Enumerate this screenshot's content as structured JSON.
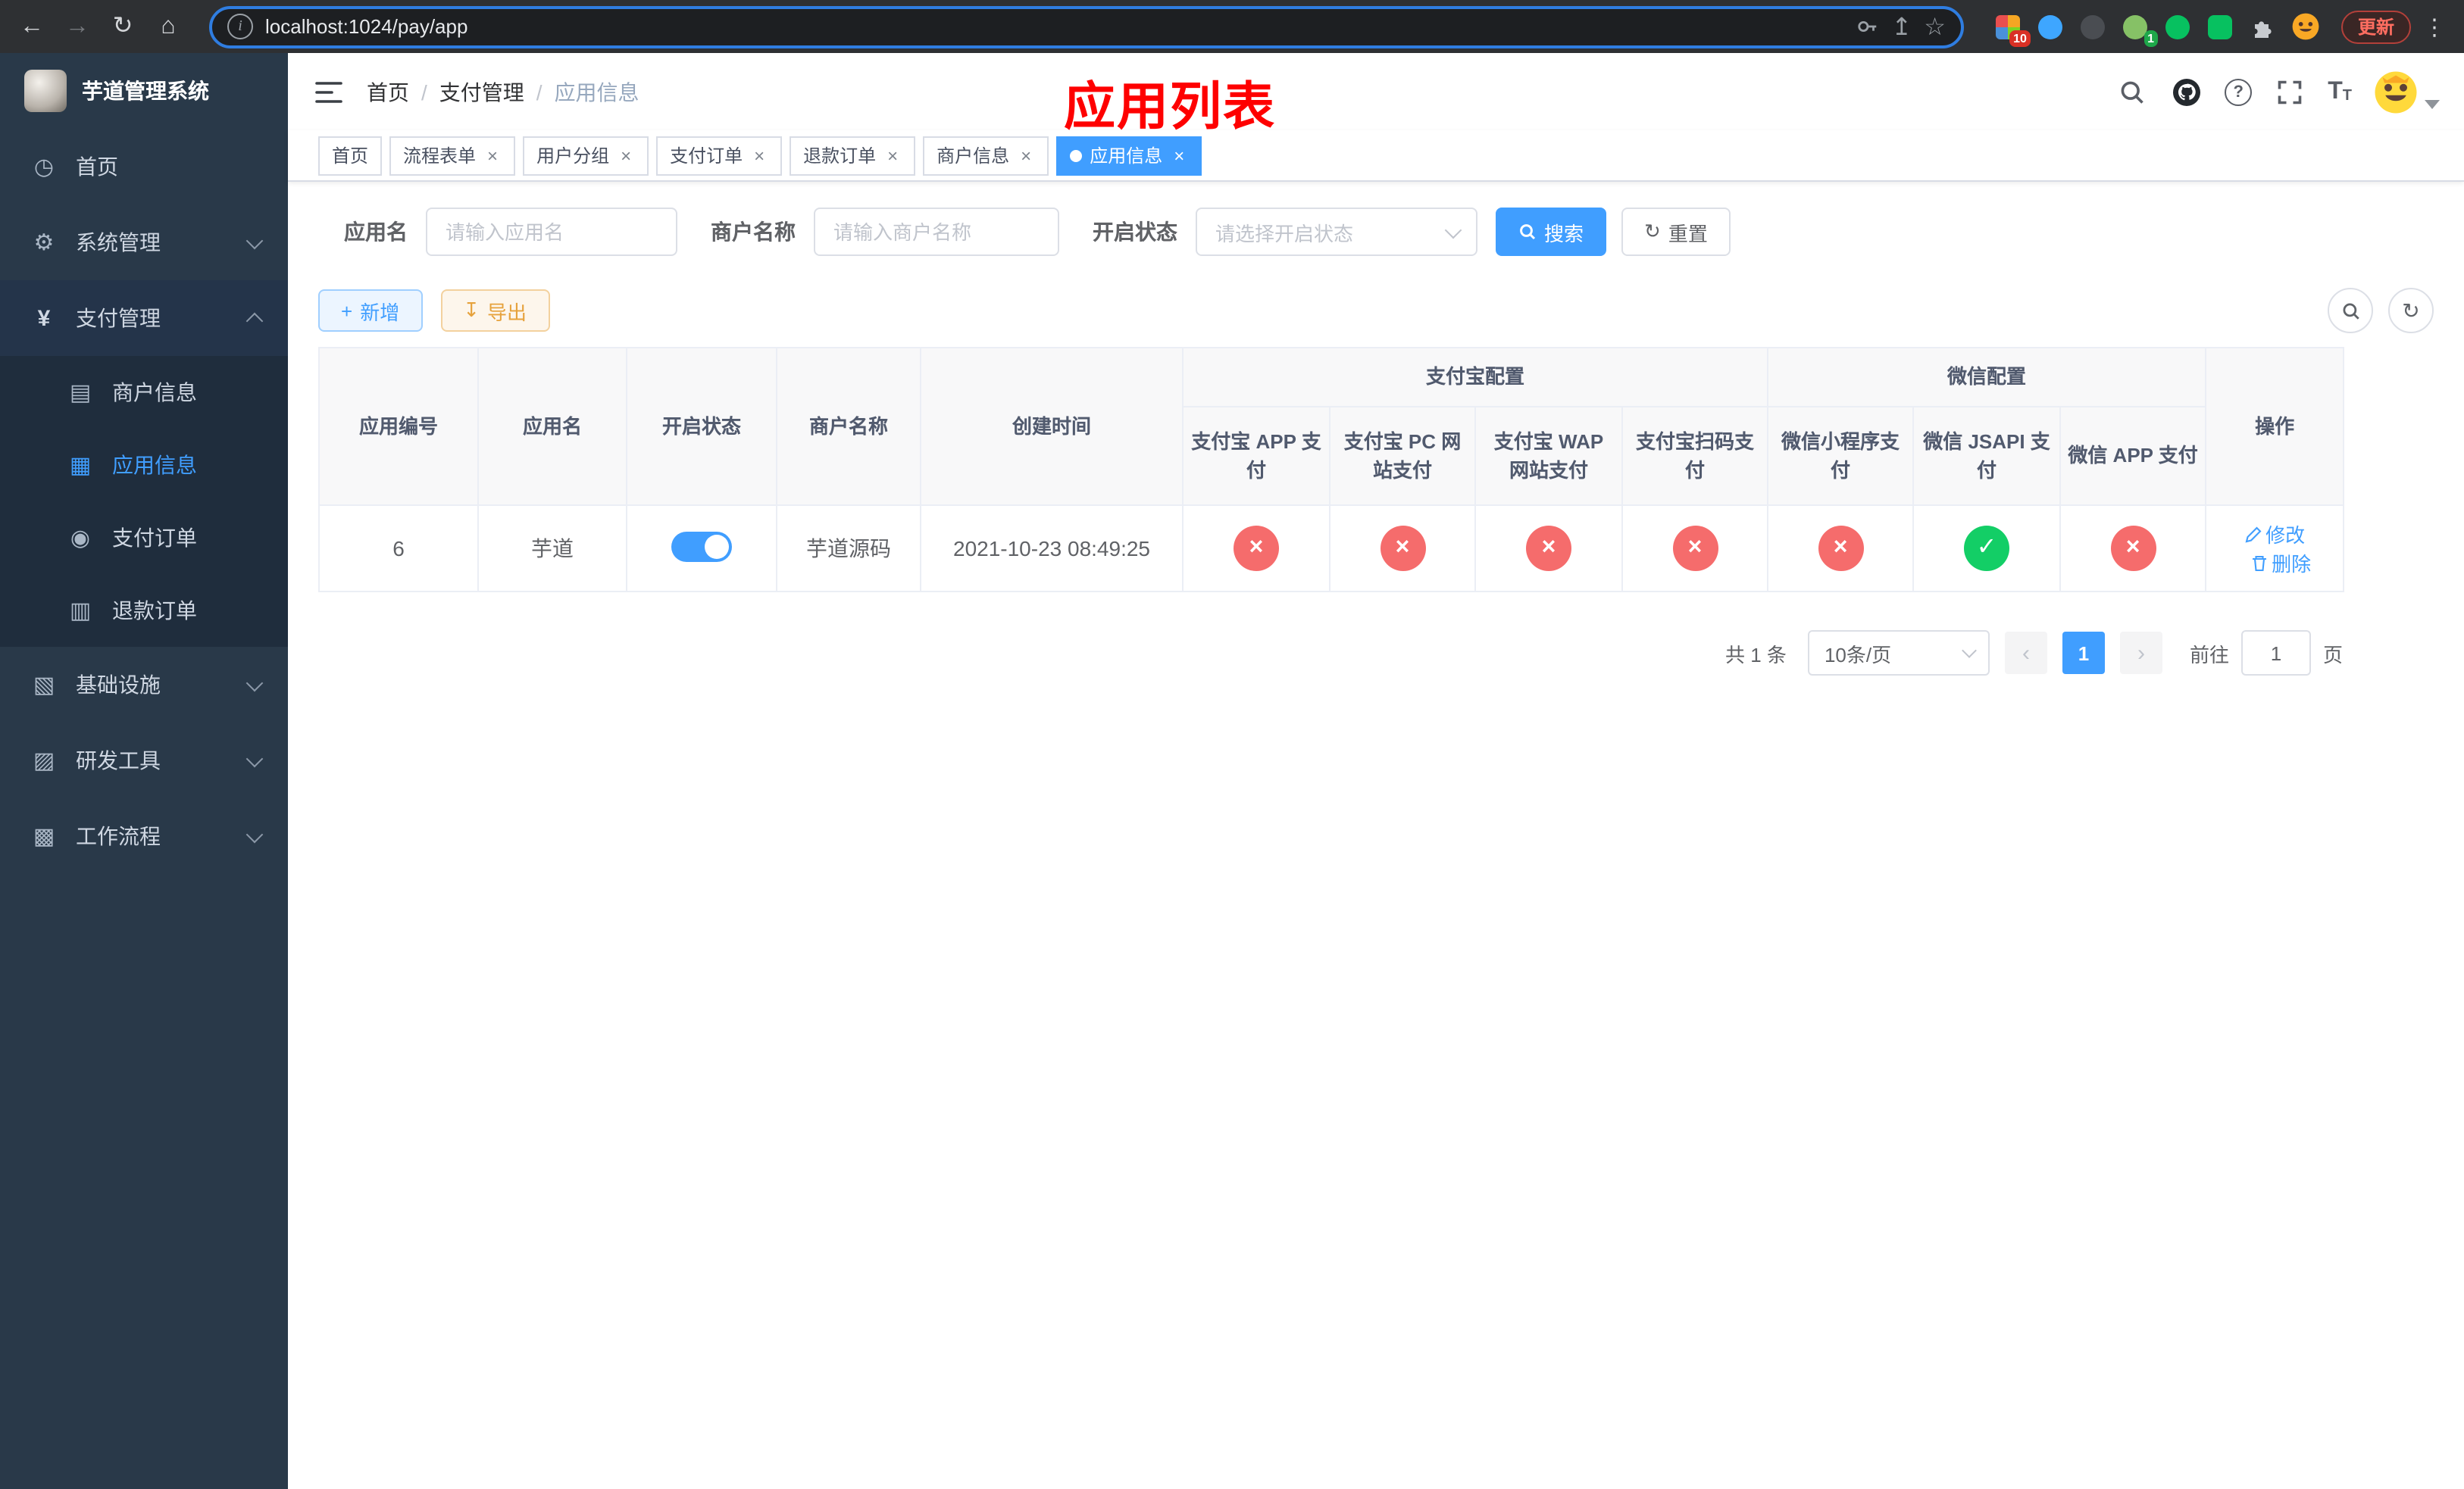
{
  "colors": {
    "accent": "#409eff",
    "danger": "#f56c6c",
    "success": "#13ce66",
    "warning": "#e6a23c",
    "sidebar_bg": "#293949",
    "sidebar_submenu_bg": "#1f2d3d",
    "overlay_title_color": "#fe0000"
  },
  "browser": {
    "url": "localhost:1024/pay/app",
    "update_label": "更新",
    "extensions_badge": "10",
    "profile_badge": "1"
  },
  "sidebar": {
    "logo_title": "芋道管理系统",
    "items": [
      {
        "label": "首页"
      },
      {
        "label": "系统管理",
        "expandable": true
      },
      {
        "label": "支付管理",
        "expandable": true,
        "expanded": true,
        "children": [
          {
            "label": "商户信息"
          },
          {
            "label": "应用信息",
            "active": true
          },
          {
            "label": "支付订单"
          },
          {
            "label": "退款订单"
          }
        ]
      },
      {
        "label": "基础设施",
        "expandable": true
      },
      {
        "label": "研发工具",
        "expandable": true
      },
      {
        "label": "工作流程",
        "expandable": true
      }
    ]
  },
  "header": {
    "breadcrumb": [
      "首页",
      "支付管理",
      "应用信息"
    ],
    "separator": "/",
    "overlay_title": "应用列表"
  },
  "tabs": [
    {
      "label": "首页",
      "closable": false
    },
    {
      "label": "流程表单",
      "closable": true
    },
    {
      "label": "用户分组",
      "closable": true
    },
    {
      "label": "支付订单",
      "closable": true
    },
    {
      "label": "退款订单",
      "closable": true
    },
    {
      "label": "商户信息",
      "closable": true
    },
    {
      "label": "应用信息",
      "closable": true,
      "active": true
    }
  ],
  "filters": {
    "app_name_label": "应用名",
    "app_name_placeholder": "请输入应用名",
    "merchant_label": "商户名称",
    "merchant_placeholder": "请输入商户名称",
    "status_label": "开启状态",
    "status_placeholder": "请选择开启状态",
    "search_label": "搜索",
    "reset_label": "重置"
  },
  "toolbar": {
    "add_label": "新增",
    "export_label": "导出"
  },
  "table": {
    "groups": {
      "alipay": "支付宝配置",
      "wechat": "微信配置"
    },
    "columns": [
      "应用编号",
      "应用名",
      "开启状态",
      "商户名称",
      "创建时间",
      "支付宝 APP 支付",
      "支付宝 PC 网站支付",
      "支付宝 WAP 网站支付",
      "支付宝扫码支付",
      "微信小程序支付",
      "微信 JSAPI 支付",
      "微信 APP 支付",
      "操作"
    ],
    "rows": [
      {
        "id": "6",
        "name": "芋道",
        "enabled": true,
        "merchant": "芋道源码",
        "created": "2021-10-23 08:49:25",
        "configs": [
          false,
          false,
          false,
          false,
          false,
          true,
          false
        ],
        "edit_label": "修改",
        "delete_label": "删除"
      }
    ]
  },
  "pagination": {
    "total": "共 1 条",
    "page_size": "10条/页",
    "current_page": "1",
    "goto_prefix": "前往",
    "goto_value": "1",
    "goto_suffix": "页"
  },
  "icons": {
    "back": "←",
    "forward": "→",
    "reload": "↻",
    "home": "⌂",
    "share": "↥",
    "star": "☆",
    "more": "⋮",
    "dashboard": "◷",
    "gear": "⚙",
    "yen": "¥",
    "merchant": "▤",
    "app": "▦",
    "order": "◉",
    "refund": "▥",
    "infra": "▧",
    "devtools": "▨",
    "workflow": "▩",
    "question": "?",
    "fontsize_big": "T",
    "fontsize_small": "T",
    "plus": "+",
    "download": "↧",
    "refresh": "↻",
    "close": "×",
    "cross": "×",
    "check": "✓",
    "prev": "‹",
    "next": "›",
    "info": "i"
  }
}
